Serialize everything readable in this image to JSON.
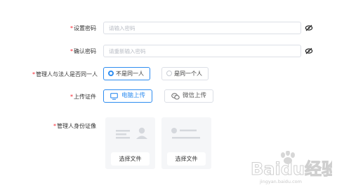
{
  "form": {
    "password": {
      "required_mark": "*",
      "label": "设置密码",
      "placeholder": "请输入密码"
    },
    "confirm_password": {
      "required_mark": "*",
      "label": "确认密码",
      "placeholder": "请重新输入密码"
    },
    "same_person": {
      "required_mark": "*",
      "label": "管理人与法人是否同一人",
      "options": [
        "不是同一人",
        "是同一个人"
      ],
      "selected": "不是同一人"
    },
    "upload_doc": {
      "required_mark": "*",
      "label": "上传证件",
      "options": [
        {
          "label": "电脑上传",
          "icon": "monitor-icon",
          "active": true
        },
        {
          "label": "微信上传",
          "icon": "wechat-icon",
          "active": false
        }
      ]
    },
    "id_photo": {
      "required_mark": "*",
      "label": "管理人身份证像",
      "front_button": "选择文件",
      "back_button": "选择文件"
    }
  },
  "watermark": {
    "brand": "Baidu经验",
    "url": "jingyan.baidu.com"
  },
  "colors": {
    "accent": "#2d8cf0",
    "required": "#f5222d",
    "border": "#dcdfe6"
  }
}
